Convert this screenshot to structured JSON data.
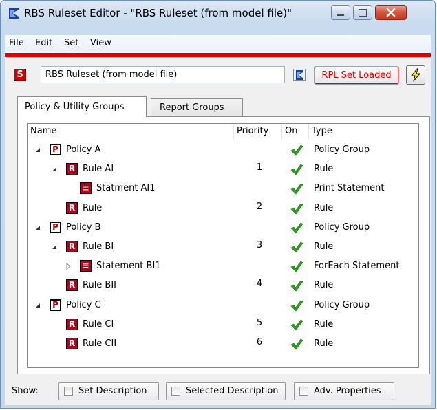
{
  "window": {
    "title": "RBS Ruleset Editor - \"RBS Ruleset (from model file)\""
  },
  "menu": {
    "items": [
      "File",
      "Edit",
      "Set",
      "View"
    ]
  },
  "toolbar": {
    "set_icon_letter": "S",
    "ruleset_name": "RBS Ruleset (from model file)",
    "rpl_button_label": "RPL Set Loaded"
  },
  "tabs": [
    {
      "label": "Policy & Utility Groups",
      "active": true
    },
    {
      "label": "Report Groups",
      "active": false
    }
  ],
  "tree": {
    "columns": [
      "Name",
      "Priority",
      "On",
      "Type"
    ],
    "rows": [
      {
        "name": "Policy A",
        "icon": "policy-icon",
        "letter": "P",
        "priority": "",
        "on": true,
        "type": "Policy Group",
        "level": 0,
        "expander": "expanded"
      },
      {
        "name": "Rule AI",
        "icon": "rule-icon",
        "letter": "R",
        "priority": "1",
        "on": true,
        "type": "Rule",
        "level": 1,
        "expander": "expanded"
      },
      {
        "name": "Statment AI1",
        "icon": "statement-icon",
        "letter": "≡",
        "priority": "",
        "on": true,
        "type": "Print Statement",
        "level": 2,
        "expander": "none"
      },
      {
        "name": "Rule",
        "icon": "rule-icon",
        "letter": "R",
        "priority": "2",
        "on": true,
        "type": "Rule",
        "level": 1,
        "expander": "none"
      },
      {
        "name": "Policy B",
        "icon": "policy-icon",
        "letter": "P",
        "priority": "",
        "on": true,
        "type": "Policy Group",
        "level": 0,
        "expander": "expanded"
      },
      {
        "name": "Rule BI",
        "icon": "rule-icon",
        "letter": "R",
        "priority": "3",
        "on": true,
        "type": "Rule",
        "level": 1,
        "expander": "expanded"
      },
      {
        "name": "Statement BI1",
        "icon": "statement-icon",
        "letter": "≡",
        "priority": "",
        "on": true,
        "type": "ForEach Statement",
        "level": 2,
        "expander": "collapsed"
      },
      {
        "name": "Rule BII",
        "icon": "rule-icon",
        "letter": "R",
        "priority": "4",
        "on": true,
        "type": "Rule",
        "level": 1,
        "expander": "none"
      },
      {
        "name": "Policy C",
        "icon": "policy-icon",
        "letter": "P",
        "priority": "",
        "on": true,
        "type": "Policy Group",
        "level": 0,
        "expander": "expanded"
      },
      {
        "name": "Rule CI",
        "icon": "rule-icon",
        "letter": "R",
        "priority": "5",
        "on": true,
        "type": "Rule",
        "level": 1,
        "expander": "none"
      },
      {
        "name": "Rule CII",
        "icon": "rule-icon",
        "letter": "R",
        "priority": "6",
        "on": true,
        "type": "Rule",
        "level": 1,
        "expander": "none"
      }
    ]
  },
  "show_bar": {
    "label": "Show:",
    "buttons": [
      {
        "label": "Set Description",
        "checked": false
      },
      {
        "label": "Selected Description",
        "checked": false
      },
      {
        "label": "Adv. Properties",
        "checked": false
      }
    ]
  },
  "colors": {
    "accent_red": "#e60000",
    "check_green": "#2e9e1f",
    "rule_icon_red": "#b3001b"
  }
}
